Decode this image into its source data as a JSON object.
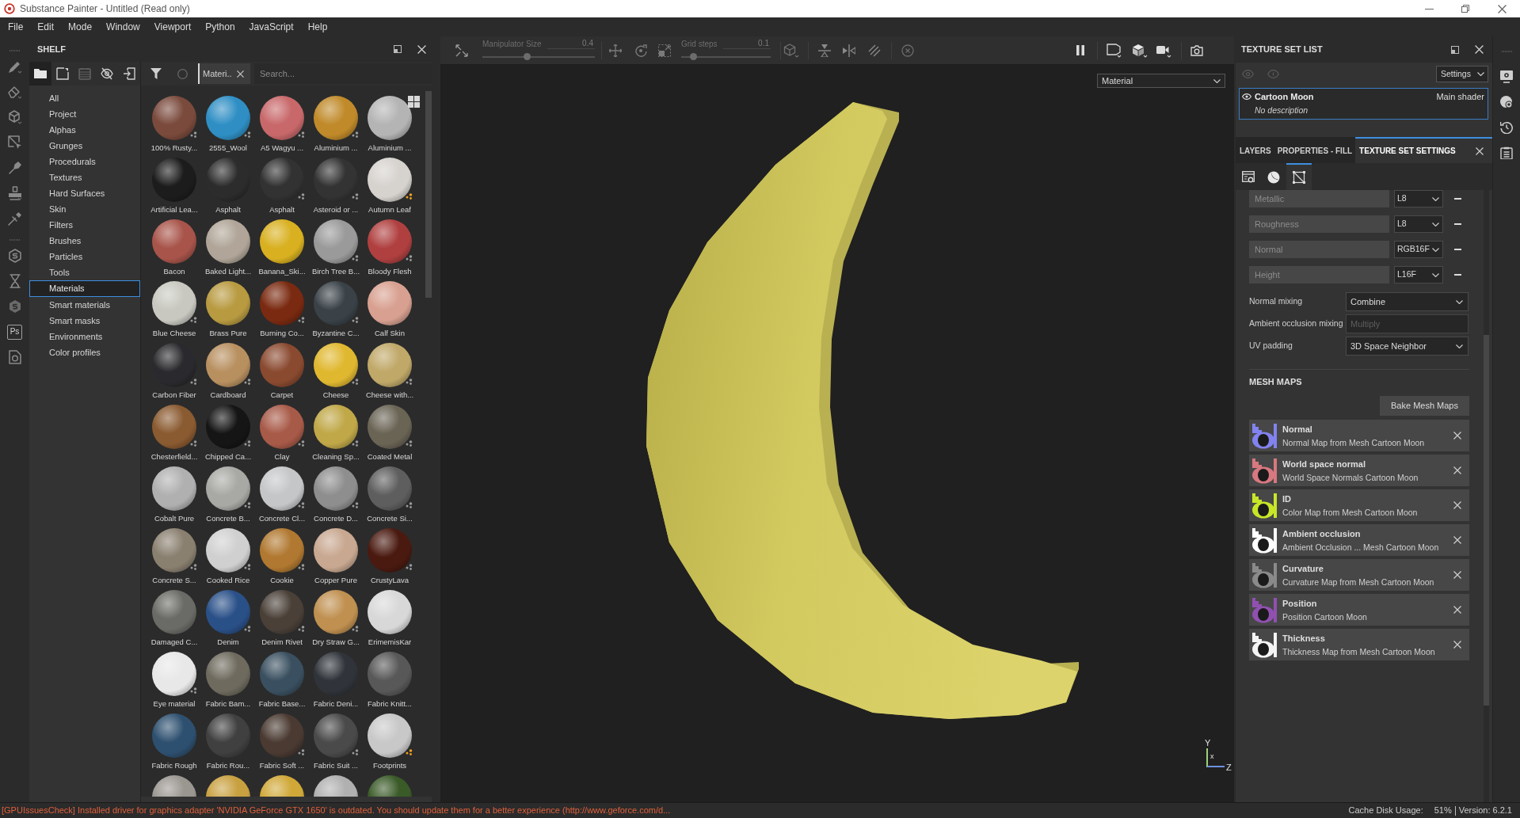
{
  "window": {
    "title": "Substance Painter - Untitled (Read only)"
  },
  "menu_bar": [
    "File",
    "Edit",
    "Mode",
    "Window",
    "Viewport",
    "Python",
    "JavaScript",
    "Help"
  ],
  "tool_strip": {
    "ps_button": "Ps"
  },
  "shelf": {
    "title": "SHELF",
    "view_buttons": [
      {
        "selected": true
      },
      {
        "selected": false
      },
      {
        "selected": false
      },
      {
        "selected": false
      },
      {
        "selected": false
      }
    ],
    "filter_tag": "Materi..",
    "search": {
      "placeholder": "Search..."
    },
    "categories": [
      {
        "label": "All",
        "selected": false
      },
      {
        "label": "Project",
        "selected": false
      },
      {
        "label": "Alphas",
        "selected": false
      },
      {
        "label": "Grunges",
        "selected": false
      },
      {
        "label": "Procedurals",
        "selected": false
      },
      {
        "label": "Textures",
        "selected": false
      },
      {
        "label": "Hard Surfaces",
        "selected": false
      },
      {
        "label": "Skin",
        "selected": false
      },
      {
        "label": "Filters",
        "selected": false
      },
      {
        "label": "Brushes",
        "selected": false
      },
      {
        "label": "Particles",
        "selected": false
      },
      {
        "label": "Tools",
        "selected": false
      },
      {
        "label": "Materials",
        "selected": true
      },
      {
        "label": "Smart materials",
        "selected": false
      },
      {
        "label": "Smart masks",
        "selected": false
      },
      {
        "label": "Environments",
        "selected": false
      },
      {
        "label": "Color profiles",
        "selected": false
      }
    ],
    "materials": [
      {
        "name": "100% Rusty...",
        "color": "#7a4a3c",
        "badge": {
          "color": "#9a9a9a"
        }
      },
      {
        "name": "2555_Wool",
        "color": "#2f8fc4",
        "badge": {
          "color": "#9a9a9a"
        }
      },
      {
        "name": "A5 Wagyu ...",
        "color": "#c8686a",
        "badge": {
          "color": "#9a9a9a"
        }
      },
      {
        "name": "Aluminium ...",
        "color": "#c08a2a",
        "badge": {
          "color": "#9a9a9a"
        }
      },
      {
        "name": "Aluminium ...",
        "color": "#b4b4b4"
      },
      {
        "name": "Artificial Lea...",
        "color": "#1c1c1c"
      },
      {
        "name": "Asphalt",
        "color": "#2c2c2c"
      },
      {
        "name": "Asphalt",
        "color": "#323232",
        "badge": {
          "color": "#9a9a9a"
        }
      },
      {
        "name": "Asteroid or ...",
        "color": "#333333",
        "badge": {
          "color": "#9a9a9a"
        }
      },
      {
        "name": "Autumn Leaf",
        "color": "#d6d2ce",
        "badge": {
          "color": "#f0a020"
        }
      },
      {
        "name": "Bacon",
        "color": "#a8544a"
      },
      {
        "name": "Baked Light...",
        "color": "#b0a598"
      },
      {
        "name": "Banana_Ski...",
        "color": "#d8b020"
      },
      {
        "name": "Birch Tree B...",
        "color": "#9a9a9a",
        "badge": {
          "color": "#9a9a9a"
        }
      },
      {
        "name": "Bloody Flesh",
        "color": "#b04040",
        "badge": {
          "color": "#9a9a9a"
        }
      },
      {
        "name": "Blue Cheese",
        "color": "#c8c8c0",
        "badge": {
          "color": "#9a9a9a"
        }
      },
      {
        "name": "Brass Pure",
        "color": "#b89a40"
      },
      {
        "name": "Burning Co...",
        "color": "#7a2a10",
        "badge": {
          "color": "#9a9a9a"
        }
      },
      {
        "name": "Byzantine C...",
        "color": "#3a4248",
        "badge": {
          "color": "#9a9a9a"
        }
      },
      {
        "name": "Calf Skin",
        "color": "#d8a090"
      },
      {
        "name": "Carbon Fiber",
        "color": "#2a2a2e",
        "badge": {
          "color": "#9a9a9a"
        }
      },
      {
        "name": "Cardboard",
        "color": "#b89060",
        "badge": {
          "color": "#9a9a9a"
        }
      },
      {
        "name": "Carpet",
        "color": "#8a4a30"
      },
      {
        "name": "Cheese",
        "color": "#e0b830",
        "badge": {
          "color": "#9a9a9a"
        }
      },
      {
        "name": "Cheese with...",
        "color": "#c0a868",
        "badge": {
          "color": "#9a9a9a"
        }
      },
      {
        "name": "Chesterfield...",
        "color": "#8a5a30",
        "badge": {
          "color": "#9a9a9a"
        }
      },
      {
        "name": "Chipped Ca...",
        "color": "#151515",
        "badge": {
          "color": "#9a9a9a"
        }
      },
      {
        "name": "Clay",
        "color": "#a85a48",
        "badge": {
          "color": "#9a9a9a"
        }
      },
      {
        "name": "Cleaning Sp...",
        "color": "#c0a848",
        "badge": {
          "color": "#9a9a9a"
        }
      },
      {
        "name": "Coated Metal",
        "color": "#6a6455",
        "badge": {
          "color": "#9a9a9a"
        }
      },
      {
        "name": "Cobalt Pure",
        "color": "#b0b0b0"
      },
      {
        "name": "Concrete B...",
        "color": "#a8a8a4",
        "badge": {
          "color": "#9a9a9a"
        }
      },
      {
        "name": "Concrete Cl...",
        "color": "#c4c6c8",
        "badge": {
          "color": "#9a9a9a"
        }
      },
      {
        "name": "Concrete D...",
        "color": "#8e8e8e",
        "badge": {
          "color": "#9a9a9a"
        }
      },
      {
        "name": "Concrete Si...",
        "color": "#5e5e5e",
        "badge": {
          "color": "#9a9a9a"
        }
      },
      {
        "name": "Concrete S...",
        "color": "#8a8070",
        "badge": {
          "color": "#9a9a9a"
        }
      },
      {
        "name": "Cooked Rice",
        "color": "#d0d0d0",
        "badge": {
          "color": "#9a9a9a"
        }
      },
      {
        "name": "Cookie",
        "color": "#b07830",
        "badge": {
          "color": "#9a9a9a"
        }
      },
      {
        "name": "Copper Pure",
        "color": "#c8a890"
      },
      {
        "name": "CrustyLava",
        "color": "#4a1a10",
        "badge": {
          "color": "#9a9a9a"
        }
      },
      {
        "name": "Damaged C...",
        "color": "#6a6a66"
      },
      {
        "name": "Denim",
        "color": "#2a5088",
        "badge": {
          "color": "#9a9a9a"
        }
      },
      {
        "name": "Denim Rivet",
        "color": "#4a4038",
        "badge": {
          "color": "#9a9a9a"
        }
      },
      {
        "name": "Dry Straw G...",
        "color": "#c09050",
        "badge": {
          "color": "#9a9a9a"
        }
      },
      {
        "name": "ErimemisKar",
        "color": "#d8d8d8"
      },
      {
        "name": "Eye material",
        "color": "#e8e8e8",
        "badge": {
          "color": "#9a9a9a"
        }
      },
      {
        "name": "Fabric Bam...",
        "color": "#6e6a5e"
      },
      {
        "name": "Fabric Base...",
        "color": "#3a5060"
      },
      {
        "name": "Fabric Deni...",
        "color": "#30343a"
      },
      {
        "name": "Fabric Knitt...",
        "color": "#585858"
      },
      {
        "name": "Fabric Rough",
        "color": "#2e5070"
      },
      {
        "name": "Fabric Rou...",
        "color": "#404040"
      },
      {
        "name": "Fabric Soft ...",
        "color": "#4a3a32",
        "badge": {
          "color": "#9a9a9a"
        }
      },
      {
        "name": "Fabric Suit ...",
        "color": "#4a4a4a",
        "badge": {
          "color": "#9a9a9a"
        }
      },
      {
        "name": "Footprints",
        "color": "#c8c8c8",
        "badge": {
          "color": "#f0a020"
        }
      },
      {
        "color": "#9a9690"
      },
      {
        "color": "#c8a040"
      },
      {
        "color": "#d0a838"
      },
      {
        "color": "#b0b0b0"
      },
      {
        "color": "#3a5a28"
      }
    ]
  },
  "viewport": {
    "sliders": [
      {
        "label": "Manipulator Size",
        "reading": "0.4",
        "level": 0.4
      },
      {
        "label": "Grid steps",
        "reading": "0.1",
        "level": 0.14
      }
    ],
    "channel_select": "Material",
    "axis_labels": [
      "Y",
      "x",
      "Z"
    ]
  },
  "texture_set_list": {
    "title": "TEXTURE SET LIST",
    "settings_button": "Settings",
    "items": [
      {
        "name": "Cartoon Moon",
        "shader": "Main shader",
        "description": "No description",
        "selected": true
      }
    ]
  },
  "tabs": [
    {
      "label": "LAYERS",
      "selected": false
    },
    {
      "label": "PROPERTIES - FILL",
      "selected": false
    },
    {
      "label": "TEXTURE SET SETTINGS",
      "selected": true
    }
  ],
  "sub_tabs": [
    {
      "selected": false
    },
    {
      "selected": false
    },
    {
      "selected": true
    }
  ],
  "channels": [
    {
      "name": "Metallic",
      "format": "L8"
    },
    {
      "name": "Roughness",
      "format": "L8"
    },
    {
      "name": "Normal",
      "format": "RGB16F"
    },
    {
      "name": "Height",
      "format": "L16F"
    }
  ],
  "settings": [
    {
      "label": "Normal mixing",
      "value": "Combine",
      "disabled": false
    },
    {
      "label": "Ambient occlusion mixing",
      "value": "Multiply",
      "disabled": true
    },
    {
      "label": "UV padding",
      "value": "3D Space Neighbor",
      "disabled": false
    }
  ],
  "mesh_maps": {
    "title": "MESH MAPS",
    "bake_button": "Bake Mesh Maps",
    "items": [
      {
        "name": "Normal",
        "source": "Normal Map from Mesh Cartoon Moon",
        "color": "#8282f0"
      },
      {
        "name": "World space normal",
        "source": "World Space Normals Cartoon Moon",
        "color": "#d87880"
      },
      {
        "name": "ID",
        "source": "Color Map from Mesh Cartoon Moon",
        "color": "#c8e628"
      },
      {
        "name": "Ambient occlusion",
        "source": "Ambient Occlusion ... Mesh Cartoon Moon",
        "color": "#ffffff"
      },
      {
        "name": "Curvature",
        "source": "Curvature Map from Mesh Cartoon Moon",
        "color": "#8a8a8a"
      },
      {
        "name": "Position",
        "source": "Position Cartoon Moon",
        "color": "#9050b0"
      },
      {
        "name": "Thickness",
        "source": "Thickness Map from Mesh Cartoon Moon",
        "color": "#f4f4f4"
      }
    ]
  },
  "status_bar": {
    "message": "[GPUIssuesCheck] Installed driver for graphics adapter 'NVIDIA GeForce GTX 1650' is outdated. You should update them for a better experience (http://www.geforce.com/d...",
    "cache_label": "Cache Disk Usage:",
    "cache_value": "51%",
    "version": "Version: 6.2.1"
  }
}
